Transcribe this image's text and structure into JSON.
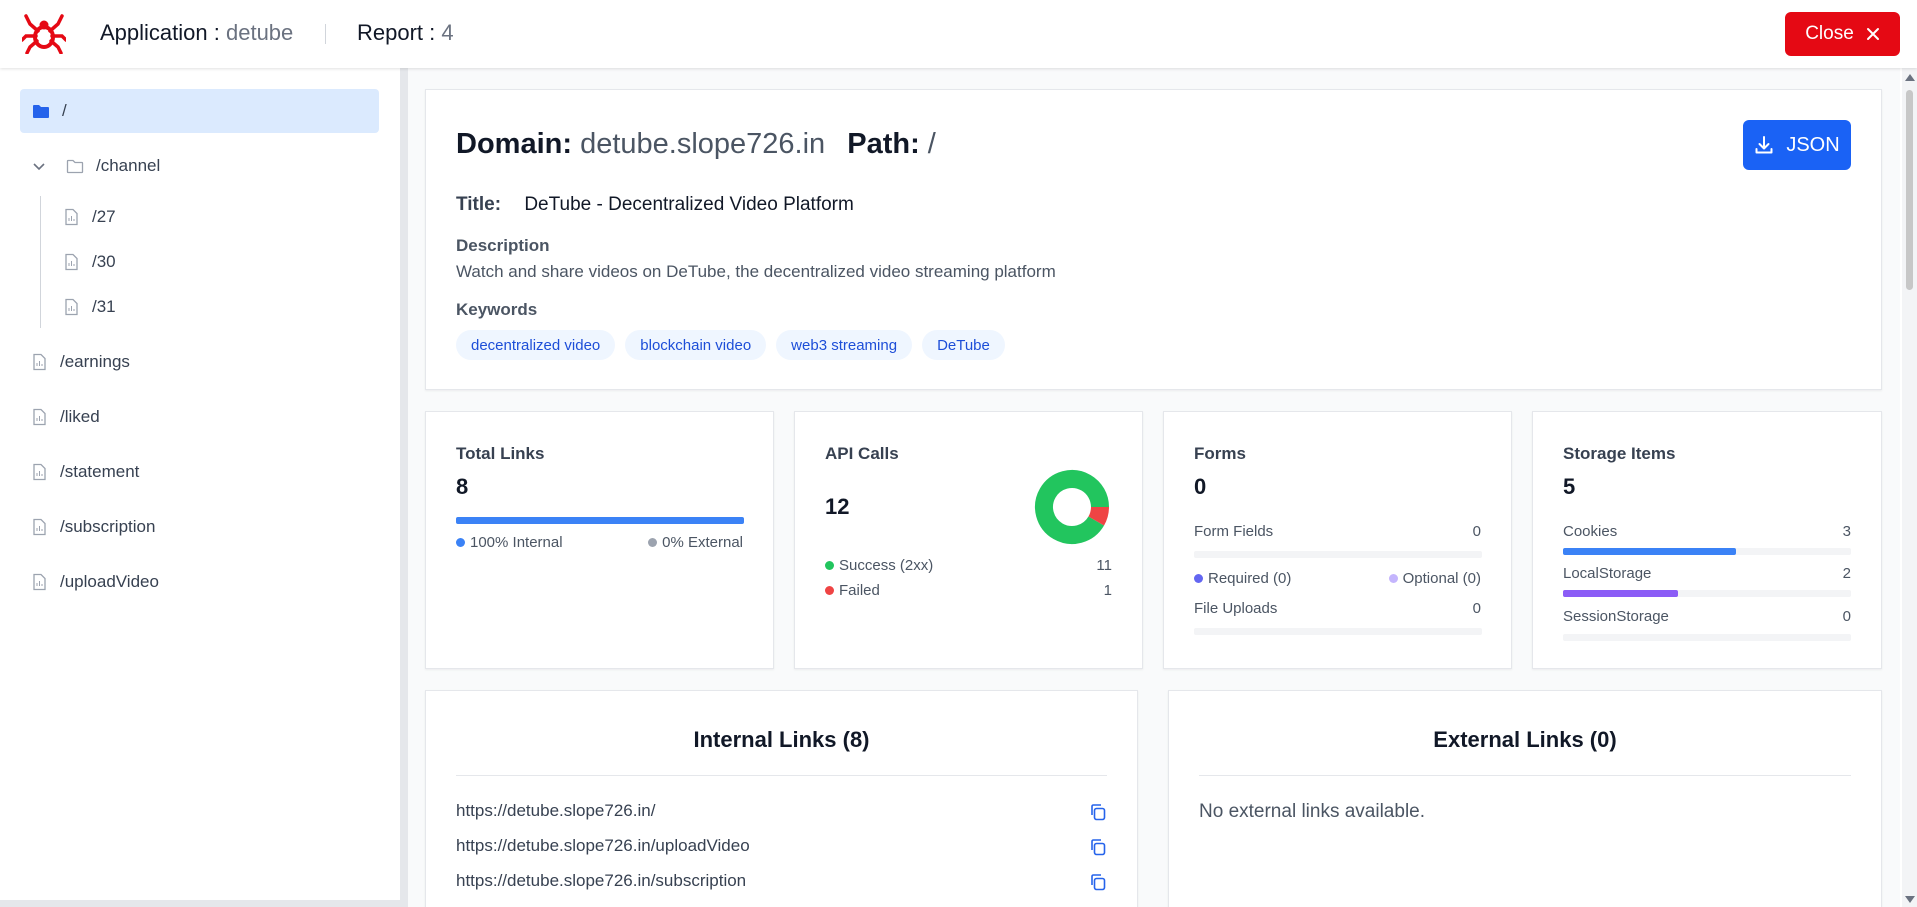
{
  "header": {
    "app_label": "Application :",
    "app_name": "detube",
    "report_label": "Report :",
    "report_number": "4",
    "close_label": "Close"
  },
  "sidebar": {
    "items": [
      {
        "label": "/",
        "icon": "folder-solid-icon",
        "active": true
      },
      {
        "label": "/channel",
        "icon": "folder-outline-icon",
        "expanded": true
      },
      {
        "label": "/27",
        "icon": "file-icon"
      },
      {
        "label": "/30",
        "icon": "file-icon"
      },
      {
        "label": "/31",
        "icon": "file-icon"
      },
      {
        "label": "/earnings",
        "icon": "file-icon"
      },
      {
        "label": "/liked",
        "icon": "file-icon"
      },
      {
        "label": "/statement",
        "icon": "file-icon"
      },
      {
        "label": "/subscription",
        "icon": "file-icon"
      },
      {
        "label": "/uploadVideo",
        "icon": "file-icon"
      }
    ]
  },
  "overview": {
    "domain_label": "Domain:",
    "domain_value": "detube.slope726.in",
    "path_label": "Path:",
    "path_value": "/",
    "json_label": "JSON",
    "title_label": "Title:",
    "title_value": "DeTube - Decentralized Video Platform",
    "description_label": "Description",
    "description_value": "Watch and share videos on DeTube, the decentralized video streaming platform",
    "keywords_label": "Keywords",
    "keywords": [
      "decentralized video",
      "blockchain video",
      "web3 streaming",
      "DeTube"
    ]
  },
  "stats": {
    "total_links": {
      "title": "Total Links",
      "value": "8",
      "internal_label": "100% Internal",
      "external_label": "0% External",
      "internal_fraction": 1.0
    },
    "api_calls": {
      "title": "API Calls",
      "value": "12",
      "success_label": "Success (2xx)",
      "success_count": "11",
      "failed_label": "Failed",
      "failed_count": "1"
    },
    "forms": {
      "title": "Forms",
      "value": "0",
      "form_fields_label": "Form Fields",
      "form_fields_count": "0",
      "required_label": "Required (0)",
      "optional_label": "Optional (0)",
      "file_uploads_label": "File Uploads",
      "file_uploads_count": "0"
    },
    "storage": {
      "title": "Storage Items",
      "value": "5",
      "cookies_label": "Cookies",
      "cookies_count": "3",
      "local_label": "LocalStorage",
      "local_count": "2",
      "session_label": "SessionStorage",
      "session_count": "0"
    }
  },
  "internal_links": {
    "title": "Internal Links (8)",
    "items": [
      "https://detube.slope726.in/",
      "https://detube.slope726.in/uploadVideo",
      "https://detube.slope726.in/subscription"
    ]
  },
  "external_links": {
    "title": "External Links (0)",
    "empty_message": "No external links available."
  },
  "colors": {
    "brand_red": "#e50914",
    "primary_blue": "#1a62f5",
    "success_green": "#22c55e",
    "failed_red": "#ef4444",
    "required_purple": "#6366f1",
    "optional_lavender": "#c4b5fd",
    "local_storage_purple": "#8b5cf6"
  }
}
